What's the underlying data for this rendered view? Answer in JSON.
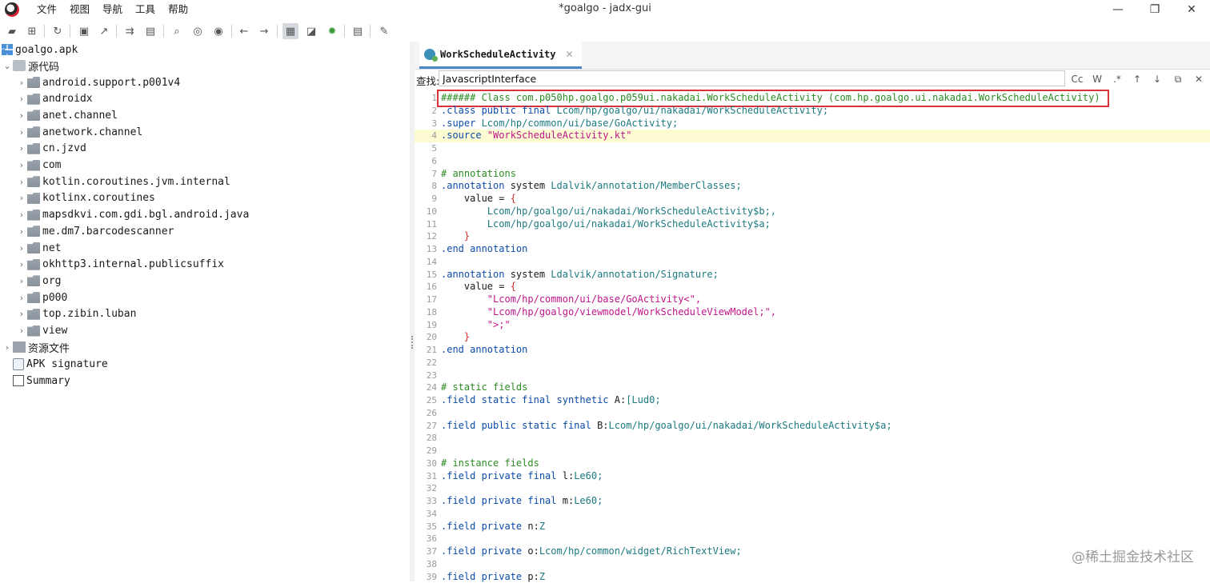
{
  "window": {
    "title": "*goalgo - jadx-gui",
    "minimize": "—",
    "maximize": "❐",
    "close": "✕"
  },
  "menu": [
    "文件",
    "视图",
    "导航",
    "工具",
    "帮助"
  ],
  "toolbar": {
    "icons": [
      "open-folder-icon",
      "add-files-icon",
      "reload-icon",
      "save-icon",
      "export-icon",
      "sync-tree-icon",
      "flatten-packages-icon",
      "search-icon",
      "find-usages-icon",
      "find-class-icon",
      "back-icon",
      "forward-icon",
      "deobfuscation-icon",
      "quark-icon",
      "debug-icon",
      "log-icon",
      "preferences-icon"
    ]
  },
  "tree": {
    "root": "goalgo.apk",
    "source_node": "源代码",
    "packages": [
      "android.support.p001v4",
      "androidx",
      "anet.channel",
      "anetwork.channel",
      "cn.jzvd",
      "com",
      "kotlin.coroutines.jvm.internal",
      "kotlinx.coroutines",
      "mapsdkvi.com.gdi.bgl.android.java",
      "me.dm7.barcodescanner",
      "net",
      "okhttp3.internal.publicsuffix",
      "org",
      "p000",
      "top.zibin.luban",
      "view"
    ],
    "resources_node": "资源文件",
    "apk_signature": "APK signature",
    "summary": "Summary"
  },
  "tab": {
    "title": "WorkScheduleActivity",
    "close": "✕"
  },
  "find": {
    "label": "查找:",
    "value": "JavascriptInterface",
    "buttons": [
      "Cc",
      "W",
      ".*",
      "↑",
      "↓",
      "⧉",
      "✕"
    ]
  },
  "code_lines": [
    {
      "n": "1",
      "spans": [
        {
          "c": "cmt",
          "t": "###### Class com.p050hp.goalgo.p059ui.nakadai.WorkScheduleActivity (com.hp.goalgo.ui.nakadai.WorkScheduleActivity)"
        }
      ]
    },
    {
      "n": "2",
      "spans": [
        {
          "c": "dir",
          "t": ".class "
        },
        {
          "c": "kw",
          "t": "public final "
        },
        {
          "c": "type",
          "t": "Lcom/hp/goalgo/ui/nakadai/WorkScheduleActivity;"
        }
      ]
    },
    {
      "n": "3",
      "spans": [
        {
          "c": "dir",
          "t": ".super "
        },
        {
          "c": "type",
          "t": "Lcom/hp/common/ui/base/GoActivity;"
        }
      ]
    },
    {
      "n": "4",
      "hl": true,
      "spans": [
        {
          "c": "dir",
          "t": ".source "
        },
        {
          "c": "str",
          "t": "\"WorkScheduleActivity.kt\""
        }
      ]
    },
    {
      "n": "5",
      "spans": []
    },
    {
      "n": "6",
      "spans": []
    },
    {
      "n": "7",
      "spans": [
        {
          "c": "cmt",
          "t": "# annotations"
        }
      ]
    },
    {
      "n": "8",
      "spans": [
        {
          "c": "dir",
          "t": ".annotation "
        },
        {
          "c": "plain",
          "t": "system "
        },
        {
          "c": "type",
          "t": "Ldalvik/annotation/MemberClasses;"
        }
      ]
    },
    {
      "n": "9",
      "spans": [
        {
          "c": "plain",
          "t": "    value = "
        },
        {
          "c": "br",
          "t": "{"
        }
      ]
    },
    {
      "n": "10",
      "spans": [
        {
          "c": "type",
          "t": "        Lcom/hp/goalgo/ui/nakadai/WorkScheduleActivity$b;,"
        }
      ]
    },
    {
      "n": "11",
      "spans": [
        {
          "c": "type",
          "t": "        Lcom/hp/goalgo/ui/nakadai/WorkScheduleActivity$a;"
        }
      ]
    },
    {
      "n": "12",
      "spans": [
        {
          "c": "br",
          "t": "    }"
        }
      ]
    },
    {
      "n": "13",
      "spans": [
        {
          "c": "dir",
          "t": ".end annotation"
        }
      ]
    },
    {
      "n": "14",
      "spans": []
    },
    {
      "n": "15",
      "spans": [
        {
          "c": "dir",
          "t": ".annotation "
        },
        {
          "c": "plain",
          "t": "system "
        },
        {
          "c": "type",
          "t": "Ldalvik/annotation/Signature;"
        }
      ]
    },
    {
      "n": "16",
      "spans": [
        {
          "c": "plain",
          "t": "    value = "
        },
        {
          "c": "br",
          "t": "{"
        }
      ]
    },
    {
      "n": "17",
      "spans": [
        {
          "c": "str",
          "t": "        \"Lcom/hp/common/ui/base/GoActivity<\","
        }
      ]
    },
    {
      "n": "18",
      "spans": [
        {
          "c": "str",
          "t": "        \"Lcom/hp/goalgo/viewmodel/WorkScheduleViewModel;\","
        }
      ]
    },
    {
      "n": "19",
      "spans": [
        {
          "c": "str",
          "t": "        \">;\""
        }
      ]
    },
    {
      "n": "20",
      "spans": [
        {
          "c": "br",
          "t": "    }"
        }
      ]
    },
    {
      "n": "21",
      "spans": [
        {
          "c": "dir",
          "t": ".end annotation"
        }
      ]
    },
    {
      "n": "22",
      "spans": []
    },
    {
      "n": "23",
      "spans": []
    },
    {
      "n": "24",
      "spans": [
        {
          "c": "cmt",
          "t": "# static fields"
        }
      ]
    },
    {
      "n": "25",
      "spans": [
        {
          "c": "dir",
          "t": ".field "
        },
        {
          "c": "kw",
          "t": "static final synthetic "
        },
        {
          "c": "plain",
          "t": "A:"
        },
        {
          "c": "type",
          "t": "[Lud0;"
        }
      ]
    },
    {
      "n": "26",
      "spans": []
    },
    {
      "n": "27",
      "spans": [
        {
          "c": "dir",
          "t": ".field "
        },
        {
          "c": "kw",
          "t": "public static final "
        },
        {
          "c": "plain",
          "t": "B:"
        },
        {
          "c": "type",
          "t": "Lcom/hp/goalgo/ui/nakadai/WorkScheduleActivity$a;"
        }
      ]
    },
    {
      "n": "28",
      "spans": []
    },
    {
      "n": "29",
      "spans": []
    },
    {
      "n": "30",
      "spans": [
        {
          "c": "cmt",
          "t": "# instance fields"
        }
      ]
    },
    {
      "n": "31",
      "spans": [
        {
          "c": "dir",
          "t": ".field "
        },
        {
          "c": "kw",
          "t": "private final "
        },
        {
          "c": "plain",
          "t": "l:"
        },
        {
          "c": "type",
          "t": "Le60;"
        }
      ]
    },
    {
      "n": "32",
      "spans": []
    },
    {
      "n": "33",
      "spans": [
        {
          "c": "dir",
          "t": ".field "
        },
        {
          "c": "kw",
          "t": "private final "
        },
        {
          "c": "plain",
          "t": "m:"
        },
        {
          "c": "type",
          "t": "Le60;"
        }
      ]
    },
    {
      "n": "34",
      "spans": []
    },
    {
      "n": "35",
      "spans": [
        {
          "c": "dir",
          "t": ".field "
        },
        {
          "c": "kw",
          "t": "private "
        },
        {
          "c": "plain",
          "t": "n:"
        },
        {
          "c": "type",
          "t": "Z"
        }
      ]
    },
    {
      "n": "36",
      "spans": []
    },
    {
      "n": "37",
      "spans": [
        {
          "c": "dir",
          "t": ".field "
        },
        {
          "c": "kw",
          "t": "private "
        },
        {
          "c": "plain",
          "t": "o:"
        },
        {
          "c": "type",
          "t": "Lcom/hp/common/widget/RichTextView;"
        }
      ]
    },
    {
      "n": "38",
      "spans": []
    },
    {
      "n": "39",
      "spans": [
        {
          "c": "dir",
          "t": ".field "
        },
        {
          "c": "kw",
          "t": "private "
        },
        {
          "c": "plain",
          "t": "p:"
        },
        {
          "c": "type",
          "t": "Z"
        }
      ]
    }
  ],
  "watermark": "@稀土掘金技术社区",
  "colors": {
    "accent": "#4a88c7",
    "highlight_box": "#d9323a",
    "current_line": "#fdfbd2"
  }
}
